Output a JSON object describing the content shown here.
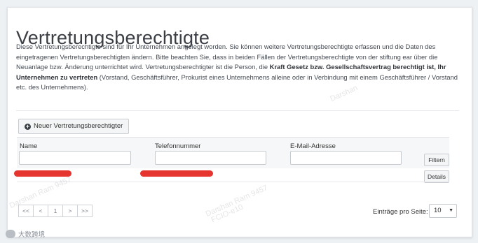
{
  "page": {
    "title": "Vertretungsberechtigte",
    "description_part1": "Diese Vertretungsberechtigte sind für Ihr Unternehmen angelegt worden. Sie können weitere Vertretungsberechtigte erfassen und die Daten des eingetragenen Vertretungsberechtigten ändern. Bitte beachten Sie, dass in beiden Fällen der Vertretungsberechtigte von der stiftung ear über die Neuanlage bzw. Änderung unterrichtet wird. Vertretungsberechtigter ist die Person, die ",
    "description_bold": "Kraft Gesetz bzw. Gesellschaftsvertrag berechtigt ist, Ihr Unternehmen zu vertreten",
    "description_part2": " (Vorstand, Geschäftsführer, Prokurist eines Unternehmens alleine oder in Verbindung mit einem Geschäftsführer / Vorstand etc. des Unternehmens)."
  },
  "toolbar": {
    "new_button_label": "Neuer Vertretungsberechtigter",
    "new_button_icon": "plus-circle-icon"
  },
  "filters": {
    "name_label": "Name",
    "name_value": "",
    "phone_label": "Telefonnummer",
    "phone_value": "",
    "email_label": "E-Mail-Adresse",
    "email_value": "",
    "filter_button": "Filtern"
  },
  "rows": [
    {
      "details_label": "Details"
    }
  ],
  "pagination": {
    "first": "<<",
    "prev": "<",
    "current": "1",
    "next": ">",
    "last": ">>",
    "page_size_label": "Einträge pro Seite:",
    "page_size_value": "10"
  },
  "watermarks": [
    "Darshan Ram 9457",
    "FCIO-e10",
    "Darshan"
  ],
  "footer": {
    "logo_text": "大数跨境"
  },
  "colors": {
    "redaction": "#e4231d"
  }
}
